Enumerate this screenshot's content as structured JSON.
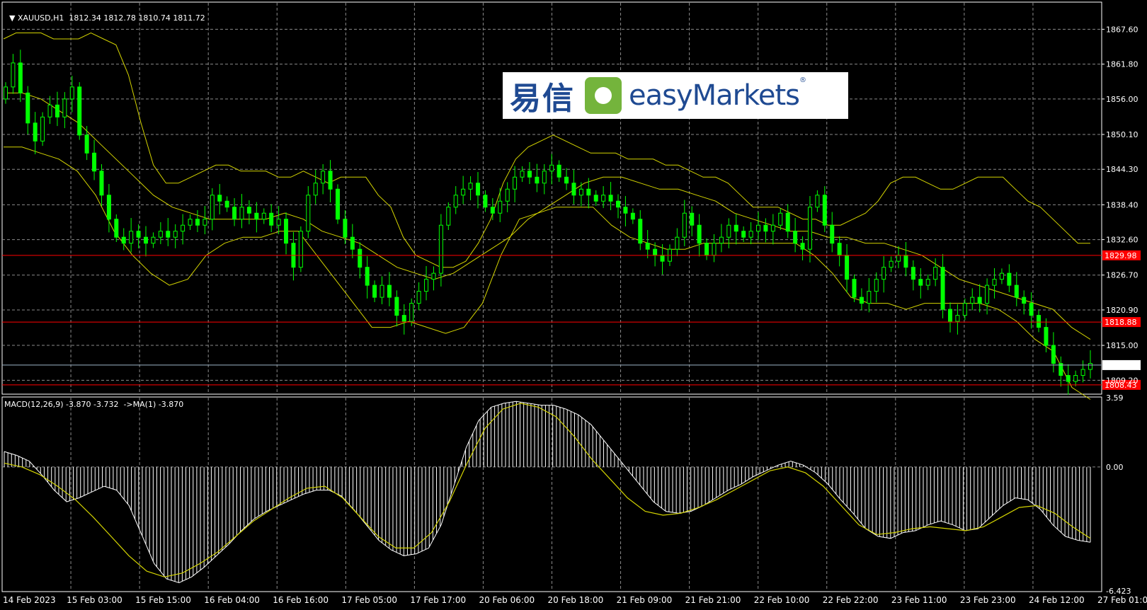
{
  "header": {
    "symbol": "XAUUSD,H1",
    "ohlc": "1812.34 1812.78 1810.74 1811.72",
    "macd_label": "MACD(12,26,9) -3.870 -3.732  ->MA(1) -3.870"
  },
  "logo": {
    "cn": "易信",
    "en": "easyMarkets",
    "reg": "®"
  },
  "colors": {
    "background": "#000000",
    "grid": "#8a8a8a",
    "candle": "#00ff00",
    "bollinger": "#d4d400",
    "level_line": "#ff0000",
    "price_line": "#9db4c8",
    "macd_hist": "#ffffff",
    "macd_signal": "#d4d400"
  },
  "chart_data": [
    {
      "type": "candlestick",
      "title": "XAUUSD,H1",
      "ylim": [
        1807,
        1872
      ],
      "y_ticks": [
        "1867.60",
        "1861.80",
        "1856.00",
        "1850.10",
        "1844.30",
        "1838.40",
        "1832.60",
        "1826.70",
        "1820.90",
        "1815.00",
        "1809.20"
      ],
      "x_ticks": [
        "14 Feb 2023",
        "15 Feb 03:00",
        "15 Feb 15:00",
        "16 Feb 04:00",
        "16 Feb 16:00",
        "17 Feb 05:00",
        "17 Feb 17:00",
        "20 Feb 06:00",
        "20 Feb 18:00",
        "21 Feb 09:00",
        "21 Feb 21:00",
        "22 Feb 10:00",
        "22 Feb 22:00",
        "23 Feb 11:00",
        "23 Feb 23:00",
        "24 Feb 12:00",
        "27 Feb 01:00"
      ],
      "close_path": [
        1858,
        1862,
        1857,
        1852,
        1849,
        1853,
        1855,
        1853,
        1856,
        1858,
        1850,
        1847,
        1844,
        1840,
        1836,
        1833,
        1832,
        1834,
        1833,
        1832,
        1833,
        1834,
        1833,
        1834,
        1835,
        1836,
        1835,
        1836,
        1840,
        1839,
        1838,
        1836,
        1838,
        1837,
        1836,
        1837,
        1835,
        1836,
        1832,
        1828,
        1834,
        1840,
        1842,
        1844,
        1841,
        1836,
        1833,
        1831,
        1828,
        1825,
        1823,
        1825,
        1823,
        1820,
        1819,
        1822,
        1824,
        1826,
        1827,
        1835,
        1838,
        1840,
        1841,
        1842,
        1840,
        1838,
        1837,
        1839,
        1841,
        1843,
        1844,
        1843,
        1842,
        1844,
        1845,
        1843,
        1842,
        1840,
        1841,
        1840,
        1839,
        1840,
        1839,
        1838,
        1837,
        1836,
        1832,
        1831,
        1830,
        1829,
        1831,
        1833,
        1837,
        1835,
        1832,
        1830,
        1832,
        1833,
        1835,
        1834,
        1833,
        1834,
        1835,
        1834,
        1835,
        1837,
        1834,
        1832,
        1831,
        1838,
        1840,
        1835,
        1832,
        1830,
        1826,
        1823,
        1822,
        1824,
        1826,
        1828,
        1829,
        1830,
        1828,
        1826,
        1825,
        1826,
        1828,
        1821,
        1819,
        1820,
        1822,
        1823,
        1822,
        1825,
        1826,
        1827,
        1825,
        1823,
        1822,
        1820,
        1818,
        1815,
        1812,
        1810,
        1809,
        1810,
        1811,
        1812
      ],
      "bb_upper": [
        1866,
        1867,
        1867,
        1867,
        1866,
        1866,
        1866,
        1867,
        1866,
        1865,
        1860,
        1852,
        1845,
        1842,
        1842,
        1843,
        1844,
        1845,
        1845,
        1844,
        1844,
        1844,
        1843,
        1843,
        1844,
        1843,
        1842,
        1843,
        1843,
        1843,
        1840,
        1838,
        1833,
        1830,
        1829,
        1828,
        1828,
        1829,
        1832,
        1836,
        1842,
        1846,
        1848,
        1849,
        1850,
        1849,
        1848,
        1847,
        1847,
        1847,
        1846,
        1846,
        1846,
        1845,
        1845,
        1844,
        1843,
        1843,
        1842,
        1840,
        1838,
        1838,
        1838,
        1837,
        1836,
        1836,
        1835,
        1835,
        1836,
        1837,
        1839,
        1842,
        1843,
        1843,
        1842,
        1841,
        1841,
        1842,
        1843,
        1843,
        1843,
        1841,
        1839,
        1838,
        1836,
        1834,
        1832,
        1832
      ],
      "bb_middle": [
        1857,
        1857,
        1856,
        1854,
        1852,
        1849,
        1846,
        1843,
        1840,
        1838,
        1837,
        1836,
        1836,
        1836,
        1836,
        1837,
        1836,
        1834,
        1833,
        1832,
        1830,
        1828,
        1827,
        1826,
        1827,
        1829,
        1831,
        1833,
        1836,
        1838,
        1840,
        1842,
        1843,
        1843,
        1842,
        1841,
        1841,
        1840,
        1839,
        1837,
        1836,
        1835,
        1834,
        1834,
        1833,
        1833,
        1832,
        1832,
        1831,
        1830,
        1828,
        1826,
        1825,
        1824,
        1823,
        1822,
        1821,
        1818,
        1816
      ],
      "bb_lower": [
        1848,
        1848,
        1847,
        1846,
        1844,
        1840,
        1834,
        1830,
        1827,
        1825,
        1826,
        1830,
        1832,
        1833,
        1833,
        1834,
        1834,
        1830,
        1826,
        1822,
        1818,
        1818,
        1819,
        1818,
        1817,
        1818,
        1822,
        1830,
        1836,
        1837,
        1838,
        1838,
        1838,
        1835,
        1833,
        1832,
        1831,
        1831,
        1832,
        1832,
        1832,
        1832,
        1832,
        1832,
        1830,
        1827,
        1823,
        1822,
        1822,
        1821,
        1822,
        1822,
        1822,
        1822,
        1821,
        1819,
        1816,
        1814,
        1808,
        1806
      ]
    },
    {
      "type": "bar",
      "title": "MACD(12,26,9) -3.870 -3.732  ->MA(1) -3.870",
      "ylim": [
        -6.423,
        3.59
      ],
      "y_ticks": [
        "3.59",
        "0.00",
        "-6.423"
      ],
      "histogram": [
        0.8,
        0.6,
        0.3,
        -0.4,
        -1.2,
        -1.8,
        -1.6,
        -1.3,
        -1.0,
        -1.2,
        -2.0,
        -3.5,
        -5.0,
        -5.8,
        -6.0,
        -5.7,
        -5.2,
        -4.6,
        -4.0,
        -3.3,
        -2.7,
        -2.3,
        -2.0,
        -1.7,
        -1.4,
        -1.2,
        -1.2,
        -1.5,
        -2.2,
        -3.0,
        -3.8,
        -4.3,
        -4.6,
        -4.5,
        -4.2,
        -3.0,
        -1.0,
        1.0,
        2.4,
        3.1,
        3.3,
        3.4,
        3.3,
        3.2,
        3.2,
        3.0,
        2.7,
        2.2,
        1.4,
        0.6,
        -0.2,
        -1.0,
        -1.8,
        -2.3,
        -2.4,
        -2.3,
        -2.0,
        -1.6,
        -1.2,
        -0.9,
        -0.5,
        -0.2,
        0.1,
        0.3,
        0.1,
        -0.3,
        -0.9,
        -1.7,
        -2.4,
        -3.2,
        -3.6,
        -3.7,
        -3.4,
        -3.3,
        -3.0,
        -2.8,
        -3.0,
        -3.3,
        -3.2,
        -2.6,
        -2.0,
        -1.6,
        -1.7,
        -2.2,
        -3.0,
        -3.6,
        -3.8,
        -3.9
      ],
      "signal": [
        0.2,
        0.0,
        -0.4,
        -1.0,
        -1.7,
        -2.6,
        -3.6,
        -4.6,
        -5.4,
        -5.7,
        -5.5,
        -5.0,
        -4.4,
        -3.6,
        -2.8,
        -2.2,
        -1.6,
        -1.1,
        -1.0,
        -1.6,
        -2.6,
        -3.6,
        -4.2,
        -4.2,
        -3.4,
        -1.8,
        0.2,
        2.0,
        3.0,
        3.3,
        3.1,
        2.6,
        1.6,
        0.4,
        -0.6,
        -1.6,
        -2.3,
        -2.5,
        -2.4,
        -2.1,
        -1.7,
        -1.2,
        -0.7,
        -0.2,
        0.0,
        -0.3,
        -1.0,
        -2.0,
        -3.0,
        -3.5,
        -3.4,
        -3.2,
        -3.1,
        -3.2,
        -3.3,
        -3.1,
        -2.6,
        -2.1,
        -2.0,
        -2.4,
        -3.1,
        -3.7
      ]
    }
  ],
  "levels": {
    "upper": "1829.98",
    "middle": "1818.88",
    "current": "1811.72",
    "lower": "1808.43"
  }
}
